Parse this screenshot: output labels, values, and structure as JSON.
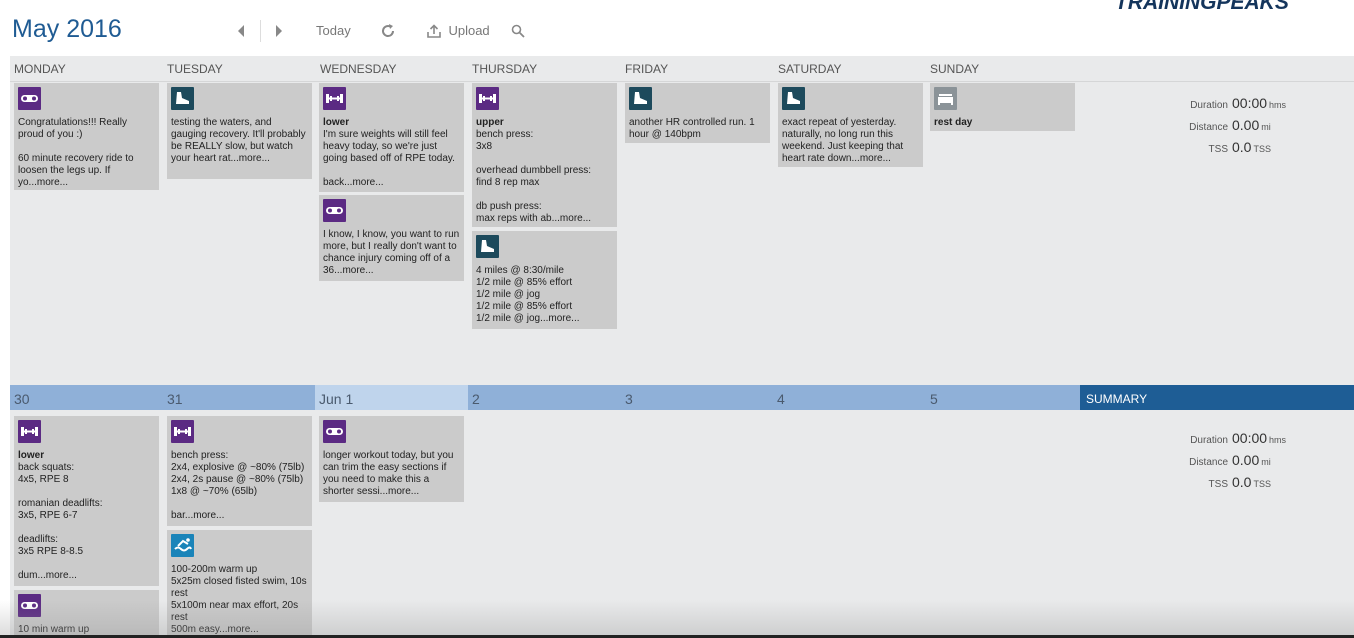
{
  "header": {
    "month": "May",
    "year": "2016",
    "logo": "TRAININGPEAKS",
    "today_label": "Today",
    "upload_label": "Upload"
  },
  "days": [
    "MONDAY",
    "TUESDAY",
    "WEDNESDAY",
    "THURSDAY",
    "FRIDAY",
    "SATURDAY",
    "SUNDAY"
  ],
  "week2_dates": [
    "30",
    "31",
    "Jun 1",
    "2",
    "3",
    "4",
    "5"
  ],
  "summary_label": "SUMMARY",
  "summary_week1": {
    "duration_label": "Duration",
    "duration_value": "00:00",
    "duration_unit": "hms",
    "distance_label": "Distance",
    "distance_value": "0.00",
    "distance_unit": "mi",
    "tss_label": "TSS",
    "tss_value": "0.0",
    "tss_unit": "TSS"
  },
  "summary_week2": {
    "duration_label": "Duration",
    "duration_value": "00:00",
    "duration_unit": "hms",
    "distance_label": "Distance",
    "distance_value": "0.00",
    "distance_unit": "mi",
    "tss_label": "TSS",
    "tss_value": "0.0",
    "tss_unit": "TSS"
  },
  "workouts": {
    "w1_mon": {
      "icon": "bike-icon",
      "title": "",
      "desc": "Congratulations!!! Really proud of you :)\n\n60 minute recovery ride to loosen the legs up. If yo...more..."
    },
    "w1_tue": {
      "icon": "run-shoe-icon",
      "title": "",
      "desc": "testing the waters, and gauging recovery. It'll probably be REALLY slow, but watch your heart rat...more..."
    },
    "w1_wed_a": {
      "icon": "strength-icon",
      "title": "lower",
      "desc": "I'm sure weights will still feel heavy today, so we're just going based off of RPE today.\n\nback...more..."
    },
    "w1_wed_b": {
      "icon": "bike-icon",
      "title": "",
      "desc": "I know, I know, you want to run more, but I really don't want to chance injury coming off of a 36...more..."
    },
    "w1_thu_a": {
      "icon": "strength-icon",
      "title": "upper",
      "desc": "bench press:\n3x8\n\noverhead dumbbell press:\nfind 8 rep max\n\ndb push press:\nmax reps with ab...more..."
    },
    "w1_thu_b": {
      "icon": "run-shoe-icon",
      "title": "",
      "desc": "4 miles @ 8:30/mile\n1/2 mile @ 85% effort\n1/2 mile @ jog\n1/2 mile @ 85% effort\n1/2 mile @ jog...more..."
    },
    "w1_fri": {
      "icon": "run-shoe-icon",
      "title": "",
      "desc": "another HR controlled run. 1 hour @ 140bpm"
    },
    "w1_sat": {
      "icon": "run-shoe-icon",
      "title": "",
      "desc": "exact repeat of yesterday. naturally, no long run this weekend. Just keeping that heart rate down...more..."
    },
    "w1_sun": {
      "icon": "rest-day-icon",
      "title": "rest day",
      "desc": ""
    },
    "w2_mon_a": {
      "icon": "strength-icon",
      "title": "lower",
      "desc": "back squats:\n4x5, RPE 8\n\nromanian deadlifts:\n3x5, RPE 6-7\n\ndeadlifts:\n3x5 RPE 8-8.5\n\ndum...more..."
    },
    "w2_mon_b": {
      "icon": "bike-icon",
      "title": "",
      "desc": "10 min warm up"
    },
    "w2_tue_a": {
      "icon": "strength-icon",
      "title": "",
      "desc": "bench press:\n2x4, explosive @ ~80% (75lb)\n2x4, 2s pause @ ~80% (75lb)\n1x8 @ ~70% (65lb)\n\nbar...more..."
    },
    "w2_tue_b": {
      "icon": "swim-icon",
      "title": "",
      "desc": "100-200m warm up\n5x25m closed fisted swim, 10s rest\n5x100m near max effort, 20s rest\n500m easy...more..."
    },
    "w2_wed": {
      "icon": "bike-icon",
      "title": "",
      "desc": "longer workout today, but you can trim the easy sections if you need to make this a shorter sessi...more..."
    }
  }
}
